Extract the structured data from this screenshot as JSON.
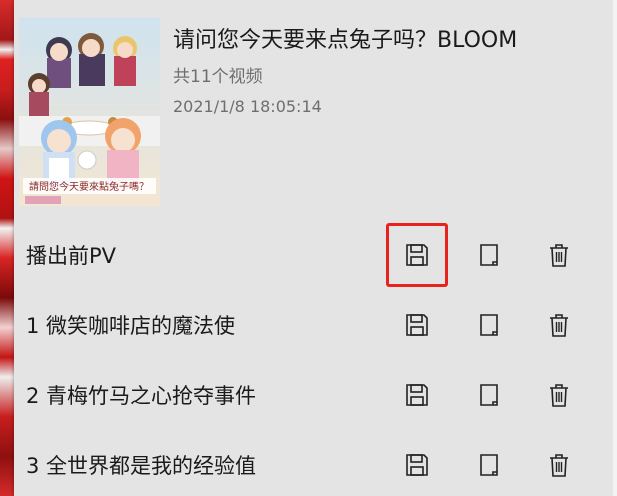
{
  "playlist": {
    "title": "请问您今天要来点兔子吗？BLOOM",
    "video_count": "共11个视频",
    "date": "2021/1/8 18:05:14",
    "cover_text": "請問您今天要來點兔子嗎？"
  },
  "episodes": [
    {
      "label": "播出前PV"
    },
    {
      "label": "1 微笑咖啡店的魔法使"
    },
    {
      "label": "2 青梅竹马之心抢夺事件"
    },
    {
      "label": "3 全世界都是我的经验值"
    }
  ],
  "icons": {
    "save": "save-icon",
    "file": "file-icon",
    "delete": "trash-icon"
  },
  "colors": {
    "panel_bg": "#e4e4e4",
    "highlight": "#e8221c",
    "secondary_text": "#6e6e6e"
  }
}
